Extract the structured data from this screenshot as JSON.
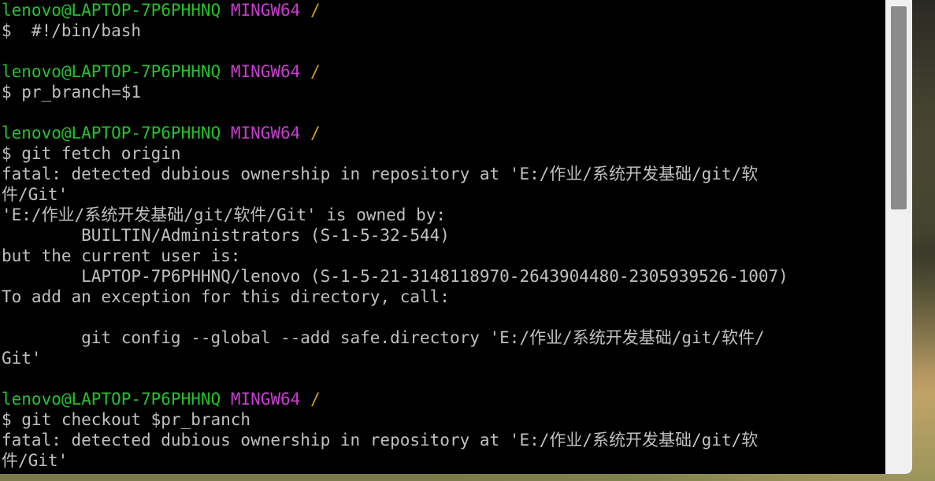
{
  "terminal": {
    "prompt": {
      "user_host": "lenovo@LAPTOP-7P6PHHNQ",
      "env": "MINGW64",
      "path": "/"
    },
    "lines": [
      {
        "kind": "prompt"
      },
      {
        "kind": "text",
        "text": "$  #!/bin/bash"
      },
      {
        "kind": "blank",
        "text": ""
      },
      {
        "kind": "prompt"
      },
      {
        "kind": "text",
        "text": "$ pr_branch=$1"
      },
      {
        "kind": "blank",
        "text": ""
      },
      {
        "kind": "prompt"
      },
      {
        "kind": "text",
        "text": "$ git fetch origin"
      },
      {
        "kind": "text",
        "text": "fatal: detected dubious ownership in repository at 'E:/作业/系统开发基础/git/软"
      },
      {
        "kind": "text",
        "text": "件/Git'"
      },
      {
        "kind": "text",
        "text": "'E:/作业/系统开发基础/git/软件/Git' is owned by:"
      },
      {
        "kind": "text",
        "text": "        BUILTIN/Administrators (S-1-5-32-544)"
      },
      {
        "kind": "text",
        "text": "but the current user is:"
      },
      {
        "kind": "text",
        "text": "        LAPTOP-7P6PHHNQ/lenovo (S-1-5-21-3148118970-2643904480-2305939526-1007)"
      },
      {
        "kind": "text",
        "text": "To add an exception for this directory, call:"
      },
      {
        "kind": "blank",
        "text": ""
      },
      {
        "kind": "text",
        "text": "        git config --global --add safe.directory 'E:/作业/系统开发基础/git/软件/"
      },
      {
        "kind": "text",
        "text": "Git'"
      },
      {
        "kind": "blank",
        "text": ""
      },
      {
        "kind": "prompt"
      },
      {
        "kind": "text",
        "text": "$ git checkout $pr_branch"
      },
      {
        "kind": "text",
        "text": "fatal: detected dubious ownership in repository at 'E:/作业/系统开发基础/git/软"
      },
      {
        "kind": "text",
        "text": "件/Git'"
      }
    ]
  },
  "scrollbar": {
    "visible_fraction": 0.44
  },
  "colors": {
    "background": "#000000",
    "text": "#c0c0c0",
    "user_host": "#22c32a",
    "env": "#c73ed0",
    "path": "#c8a21a"
  }
}
